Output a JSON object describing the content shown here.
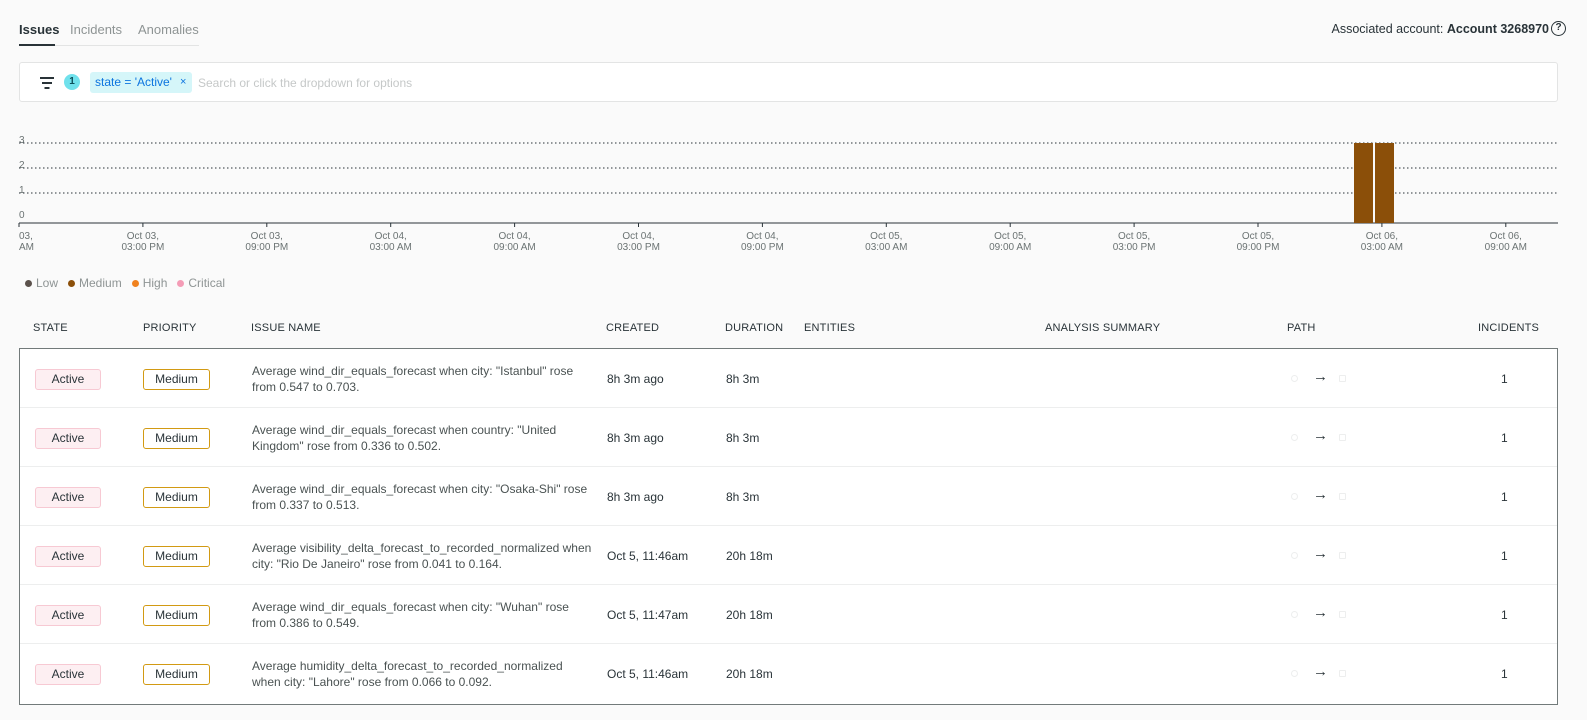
{
  "tabs": [
    {
      "label": "Issues"
    },
    {
      "label": "Incidents"
    },
    {
      "label": "Anomalies"
    }
  ],
  "account": {
    "prefix": "Associated account:",
    "name": "Account 3268970"
  },
  "filter": {
    "count": "1",
    "chip": "state = 'Active'",
    "chip_close": "×",
    "placeholder": "Search or click the dropdown for options"
  },
  "colors": {
    "medium": "#8b4f09",
    "low": "#5b514b",
    "high": "#f0821f",
    "critical": "#f49cb6",
    "active_badge": "#fdeff2",
    "priority_border": "#d29a13"
  },
  "chart_data": {
    "type": "bar",
    "title": "",
    "xlabel": "",
    "ylabel": "",
    "ylim": [
      0,
      3
    ],
    "y_ticks": [
      "0",
      "1",
      "2",
      "3"
    ],
    "x_ticks": [
      [
        "03,",
        "AM"
      ],
      [
        "Oct 03,",
        "03:00 PM"
      ],
      [
        "Oct 03,",
        "09:00 PM"
      ],
      [
        "Oct 04,",
        "03:00 AM"
      ],
      [
        "Oct 04,",
        "09:00 AM"
      ],
      [
        "Oct 04,",
        "03:00 PM"
      ],
      [
        "Oct 04,",
        "09:00 PM"
      ],
      [
        "Oct 05,",
        "03:00 AM"
      ],
      [
        "Oct 05,",
        "09:00 AM"
      ],
      [
        "Oct 05,",
        "03:00 PM"
      ],
      [
        "Oct 05,",
        "09:00 PM"
      ],
      [
        "Oct 06,",
        "03:00 AM"
      ],
      [
        "Oct 06,",
        "09:00 AM"
      ]
    ],
    "grid": true,
    "series": [
      {
        "name": "Medium",
        "values": [
          3,
          3
        ]
      }
    ],
    "legend": [
      {
        "label": "Low",
        "color": "#5b514b"
      },
      {
        "label": "Medium",
        "color": "#8b4f09"
      },
      {
        "label": "High",
        "color": "#f0821f"
      },
      {
        "label": "Critical",
        "color": "#f49cb6"
      }
    ]
  },
  "table": {
    "headers": {
      "state": "STATE",
      "priority": "PRIORITY",
      "issue_name": "ISSUE NAME",
      "created": "CREATED",
      "duration": "DURATION",
      "entities": "ENTITIES",
      "analysis": "ANALYSIS SUMMARY",
      "path": "PATH",
      "incidents": "INCIDENTS"
    },
    "rows": [
      {
        "state": "Active",
        "priority": "Medium",
        "issue": "Average wind_dir_equals_forecast when city: \"Istanbul\" rose from 0.547 to 0.703.",
        "created": "8h 3m ago",
        "duration": "8h 3m",
        "incidents": "1"
      },
      {
        "state": "Active",
        "priority": "Medium",
        "issue": "Average wind_dir_equals_forecast when country: \"United Kingdom\" rose from 0.336 to 0.502.",
        "created": "8h 3m ago",
        "duration": "8h 3m",
        "incidents": "1"
      },
      {
        "state": "Active",
        "priority": "Medium",
        "issue": "Average wind_dir_equals_forecast when city: \"Osaka-Shi\" rose from 0.337 to 0.513.",
        "created": "8h 3m ago",
        "duration": "8h 3m",
        "incidents": "1"
      },
      {
        "state": "Active",
        "priority": "Medium",
        "issue": "Average visibility_delta_forecast_to_recorded_normalized when city: \"Rio De Janeiro\" rose from 0.041 to 0.164.",
        "created": "Oct 5, 11:46am",
        "duration": "20h 18m",
        "incidents": "1"
      },
      {
        "state": "Active",
        "priority": "Medium",
        "issue": "Average wind_dir_equals_forecast when city: \"Wuhan\" rose from 0.386 to 0.549.",
        "created": "Oct 5, 11:47am",
        "duration": "20h 18m",
        "incidents": "1"
      },
      {
        "state": "Active",
        "priority": "Medium",
        "issue": "Average humidity_delta_forecast_to_recorded_normalized when city: \"Lahore\" rose from 0.066 to 0.092.",
        "created": "Oct 5, 11:46am",
        "duration": "20h 18m",
        "incidents": "1"
      }
    ],
    "path_arrow": "→"
  }
}
